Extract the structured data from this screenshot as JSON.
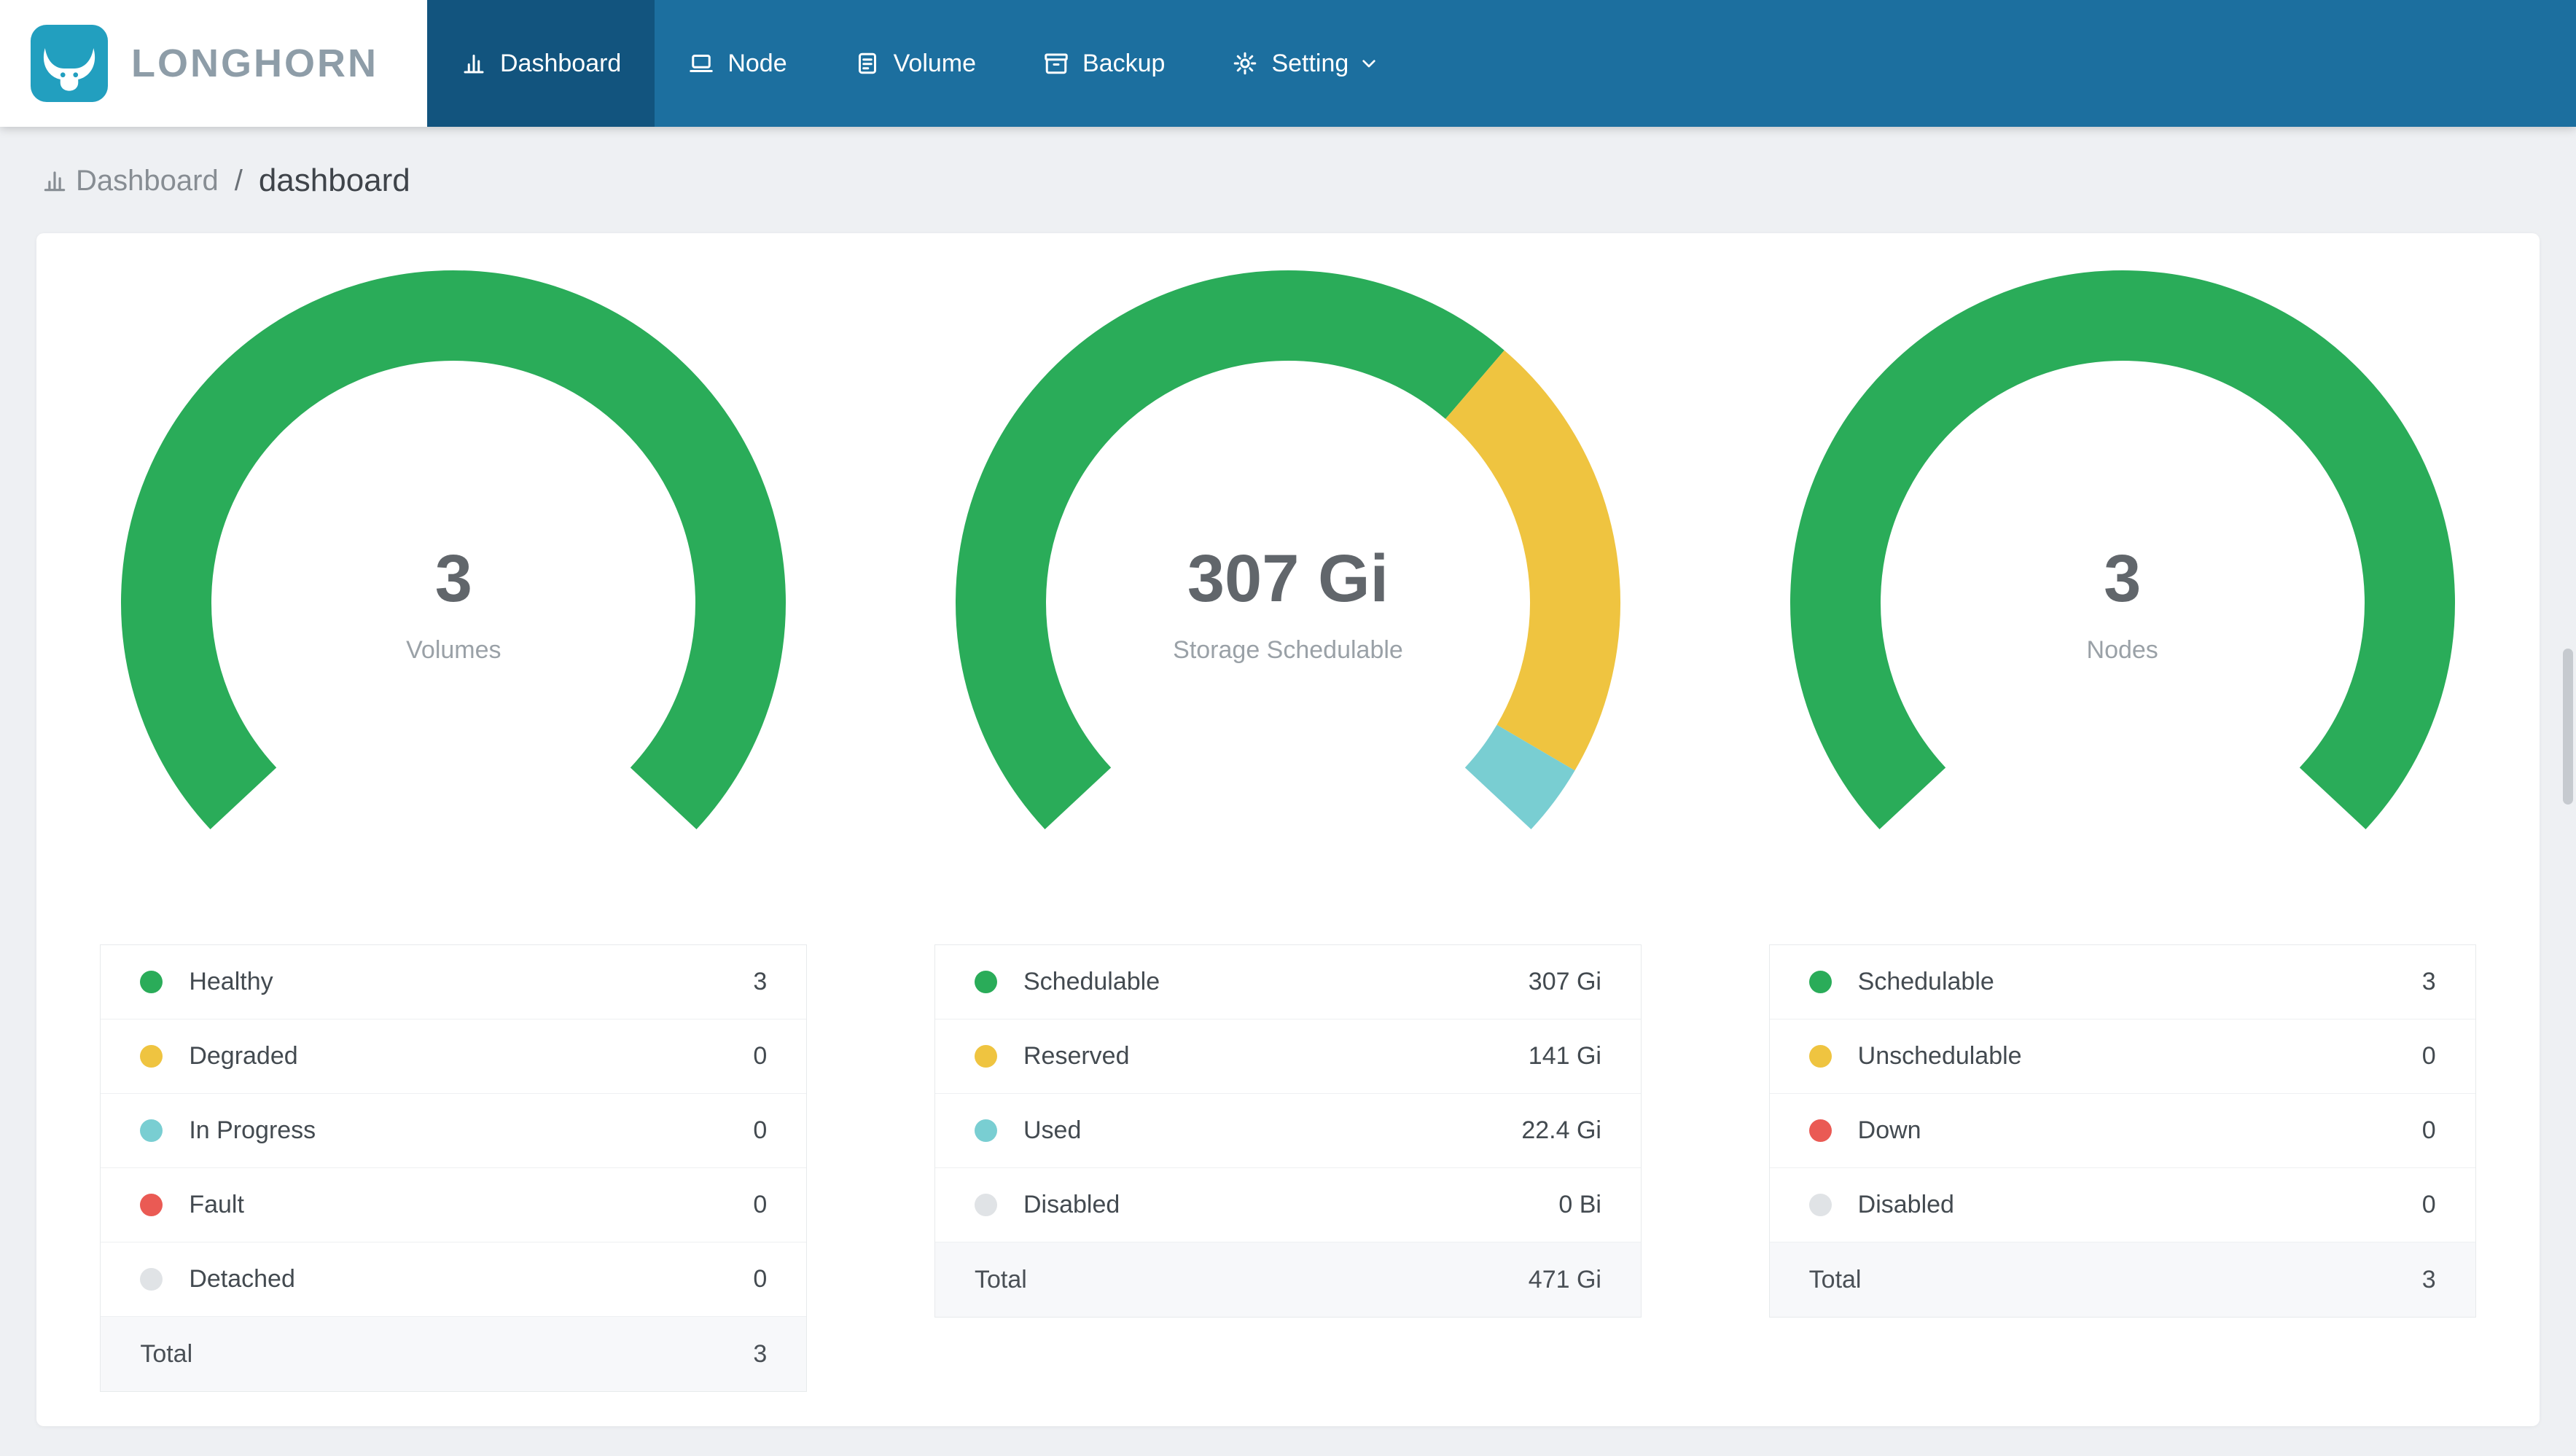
{
  "brand": {
    "name": "LONGHORN"
  },
  "nav": {
    "items": [
      {
        "label": "Dashboard",
        "icon": "dashboard-icon",
        "active": true,
        "has_dropdown": false
      },
      {
        "label": "Node",
        "icon": "node-icon",
        "active": false,
        "has_dropdown": false
      },
      {
        "label": "Volume",
        "icon": "volume-icon",
        "active": false,
        "has_dropdown": false
      },
      {
        "label": "Backup",
        "icon": "backup-icon",
        "active": false,
        "has_dropdown": false
      },
      {
        "label": "Setting",
        "icon": "setting-icon",
        "active": false,
        "has_dropdown": true
      }
    ]
  },
  "breadcrumb": {
    "section": "Dashboard",
    "separator": "/",
    "page": "dashboard"
  },
  "colors": {
    "green": "#2aac59",
    "yellow": "#efc440",
    "teal": "#79ced2",
    "red": "#ea5a54",
    "gray": "#e0e3e6",
    "navbar": "#1c6f9f",
    "navbar_active": "#12547e",
    "brand_teal": "#229fbf"
  },
  "chart_data": [
    {
      "type": "gauge",
      "title": "Volumes",
      "center_value": "3",
      "center_label": "Volumes",
      "segments": [
        {
          "name": "Healthy",
          "value": 3,
          "color": "green"
        }
      ],
      "legend": {
        "rows": [
          {
            "label": "Healthy",
            "value": "3",
            "color": "green"
          },
          {
            "label": "Degraded",
            "value": "0",
            "color": "yellow"
          },
          {
            "label": "In Progress",
            "value": "0",
            "color": "teal"
          },
          {
            "label": "Fault",
            "value": "0",
            "color": "red"
          },
          {
            "label": "Detached",
            "value": "0",
            "color": "gray"
          }
        ],
        "total_label": "Total",
        "total_value": "3"
      }
    },
    {
      "type": "gauge",
      "title": "Storage Schedulable",
      "center_value": "307 Gi",
      "center_label": "Storage Schedulable",
      "segments": [
        {
          "name": "Schedulable",
          "value": 307,
          "color": "green"
        },
        {
          "name": "Reserved",
          "value": 141,
          "color": "yellow"
        },
        {
          "name": "Used",
          "value": 22.4,
          "color": "teal"
        }
      ],
      "legend": {
        "rows": [
          {
            "label": "Schedulable",
            "value": "307 Gi",
            "color": "green"
          },
          {
            "label": "Reserved",
            "value": "141 Gi",
            "color": "yellow"
          },
          {
            "label": "Used",
            "value": "22.4 Gi",
            "color": "teal"
          },
          {
            "label": "Disabled",
            "value": "0 Bi",
            "color": "gray"
          }
        ],
        "total_label": "Total",
        "total_value": "471 Gi"
      }
    },
    {
      "type": "gauge",
      "title": "Nodes",
      "center_value": "3",
      "center_label": "Nodes",
      "segments": [
        {
          "name": "Schedulable",
          "value": 3,
          "color": "green"
        }
      ],
      "legend": {
        "rows": [
          {
            "label": "Schedulable",
            "value": "3",
            "color": "green"
          },
          {
            "label": "Unschedulable",
            "value": "0",
            "color": "yellow"
          },
          {
            "label": "Down",
            "value": "0",
            "color": "red"
          },
          {
            "label": "Disabled",
            "value": "0",
            "color": "gray"
          }
        ],
        "total_label": "Total",
        "total_value": "3"
      }
    }
  ]
}
